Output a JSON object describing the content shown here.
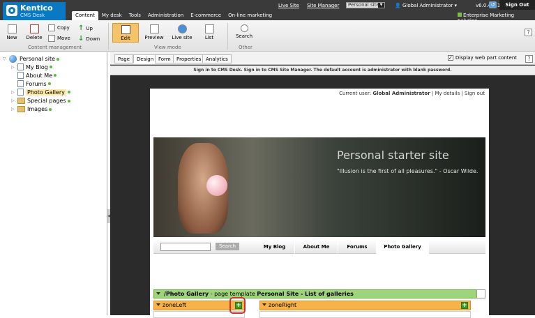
{
  "app": {
    "brand": "Kentico",
    "product": "CMS Desk"
  },
  "main_tabs": [
    "Content",
    "My desk",
    "Tools",
    "Administration",
    "E-commerce",
    "On-line marketing"
  ],
  "top_links": {
    "live_site": "Live Site",
    "site_manager": "Site Manager",
    "site_select": "Personal site",
    "user": "Global Administrator",
    "version": "v6.0.4241",
    "sign_out": "Sign Out",
    "ems": "Enterprise Marketing Solution"
  },
  "toolbar": {
    "new": "New",
    "delete": "Delete",
    "copy": "Copy",
    "move": "Move",
    "up": "Up",
    "down": "Down",
    "content_mgmt": "Content management",
    "edit": "Edit",
    "preview": "Preview",
    "live_site": "Live site",
    "list": "List",
    "view_mode": "View mode",
    "search": "Search",
    "other": "Other",
    "help": "?"
  },
  "tree": {
    "root": "Personal site",
    "items": [
      "My Blog",
      "About Me",
      "Forums",
      "Photo Gallery",
      "Special pages",
      "Images"
    ]
  },
  "sub_tabs": [
    "Page",
    "Design",
    "Form",
    "Properties",
    "Analytics"
  ],
  "display_webparts": "Display web part content",
  "info_text": "Sign in to CMS Desk. Sign in to CMS Site Manager. The default account is administrator with blank password.",
  "page": {
    "current_user_label": "Current user:",
    "current_user": "Global Administrator",
    "my_details": "My details",
    "sign_out": "Sign out",
    "banner_title": "Personal starter site",
    "banner_quote": "\"Illusion is the first of all pleasures.\" - Oscar Wilde.",
    "search_button": "Search",
    "nav": [
      "My Blog",
      "About Me",
      "Forums",
      "Photo Gallery"
    ],
    "template_path": "/Photo Gallery",
    "template_label": "- page template",
    "template_name": "Personal Site - List of galleries",
    "zone_left": "zoneLeft",
    "zone_right": "zoneRight"
  }
}
